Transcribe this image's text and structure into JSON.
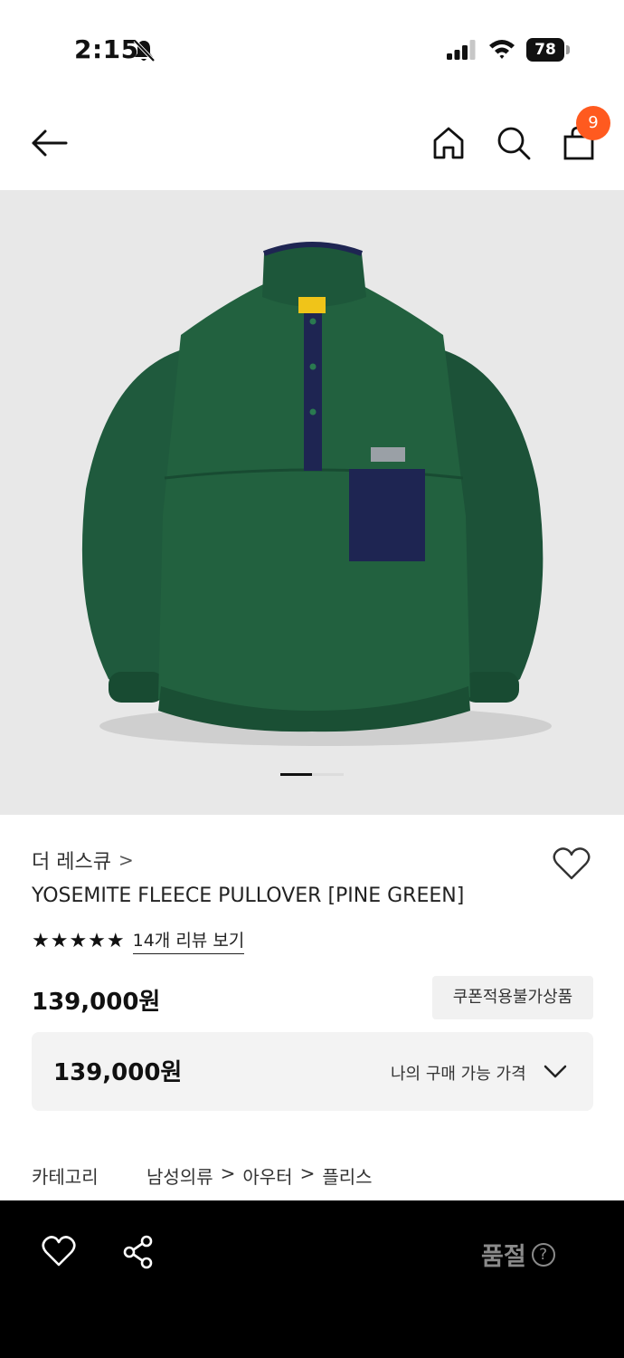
{
  "status_bar": {
    "time": "2:15",
    "battery": "78"
  },
  "nav": {
    "cart_count": "9"
  },
  "product": {
    "brand": "더 레스큐",
    "brand_chevron": ">",
    "name": "YOSEMITE FLEECE PULLOVER [PINE GREEN]",
    "stars": "★★★★★",
    "review_link": "14개 리뷰 보기",
    "price": "139,000원",
    "coupon_badge": "쿠폰적용불가상품",
    "my_price": "139,000원",
    "my_price_label": "나의 구매 가능 가격",
    "category_label": "카테고리",
    "category_path": [
      "남성의류",
      ">",
      "아우터",
      ">",
      "플리스"
    ],
    "image_count": 2,
    "image_index": 1
  },
  "bottom_bar": {
    "soldout_label": "품절",
    "help_symbol": "?"
  },
  "colors": {
    "accent_badge": "#ff5a1f",
    "fleece_green": "#1f5a3d",
    "pocket_navy": "#1e2552",
    "bottom_bar_bg": "#000000",
    "soldout_text": "#8a8a8a"
  }
}
